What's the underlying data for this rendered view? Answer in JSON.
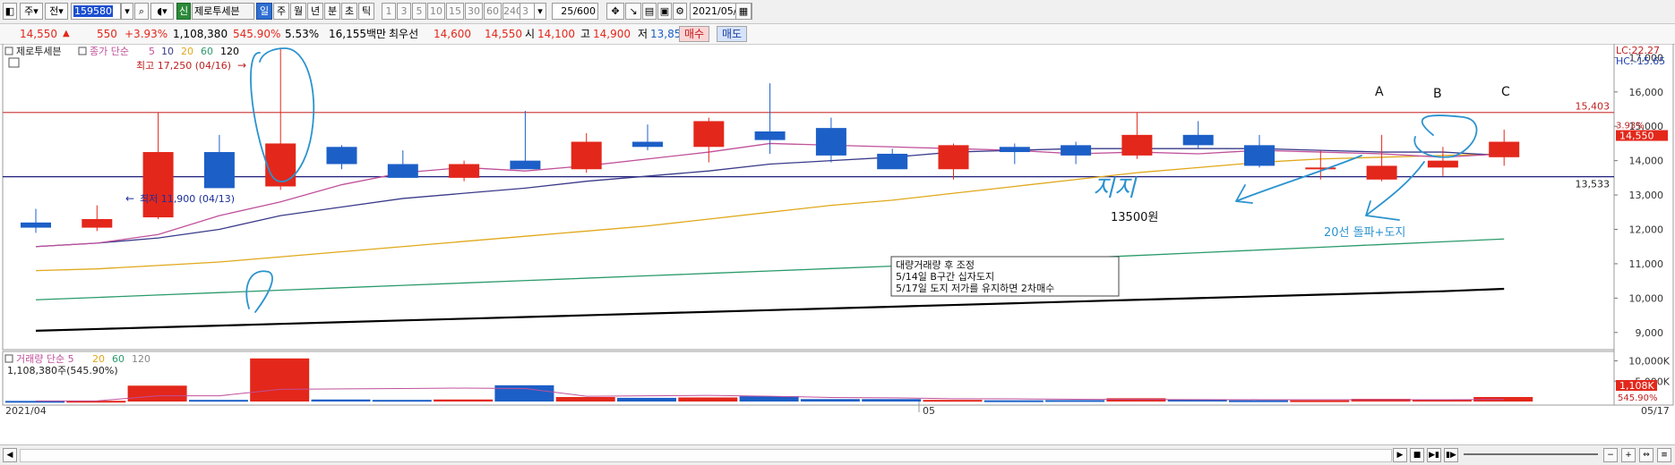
{
  "colors": {
    "up": "#e3271b",
    "down": "#1c5fc7",
    "ma5": "#c0509a",
    "ma10": "#3a3a8a",
    "ma20": "#e0a81a",
    "ma60": "#2a9a6a",
    "ma120": "#000000",
    "annot": "#2b93cf",
    "support_line": "#1f1f7a",
    "resist_line": "#d04848"
  },
  "toolbar": {
    "period_label": "주",
    "type_label": "전",
    "code": "159580",
    "sin_label": "신",
    "stock_name": "제로투세븐",
    "periods": [
      "일",
      "주",
      "월",
      "년",
      "분",
      "초",
      "틱"
    ],
    "selected_period": "일",
    "minute_options": [
      "1",
      "3",
      "5",
      "10",
      "15",
      "30",
      "60",
      "240"
    ],
    "minute_value": "3",
    "count": "25",
    "count_total": "/600",
    "date": "2021/05/17"
  },
  "quote": {
    "price": "14,550",
    "change": "550",
    "change_pct": "+3.93%",
    "volume": "1,108,380",
    "volume_pct": "545.90%",
    "turnover_pct": "5.53%",
    "amount": "16,155백만",
    "priority_label": "최우선",
    "ask": "14,600",
    "bid": "14,550",
    "open_label": "시",
    "open": "14,100",
    "high_label": "고",
    "high": "14,900",
    "low_label": "저",
    "low": "13,850",
    "buy_label": "매수",
    "sell_label": "매도"
  },
  "chart_data": {
    "type": "candlestick",
    "title": "제로투세븐",
    "legend": {
      "ma_label": "종가 단순",
      "periods": [
        "5",
        "10",
        "20",
        "60",
        "120"
      ]
    },
    "y_ticks": [
      "17,000",
      "16,000",
      "15,000",
      "14,000",
      "13,000",
      "12,000",
      "11,000",
      "10,000",
      "9,000"
    ],
    "ylim": [
      8500,
      17400
    ],
    "x_labels": [
      "2021/04",
      "05",
      "05/17"
    ],
    "candles": [
      {
        "o": 12200,
        "h": 12600,
        "l": 11900,
        "c": 12050
      },
      {
        "o": 12050,
        "h": 12700,
        "l": 11950,
        "c": 12300
      },
      {
        "o": 12350,
        "h": 15400,
        "l": 12300,
        "c": 14250
      },
      {
        "o": 14250,
        "h": 14750,
        "l": 13250,
        "c": 13200
      },
      {
        "o": 13250,
        "h": 17250,
        "l": 13150,
        "c": 14500
      },
      {
        "o": 14400,
        "h": 14450,
        "l": 13750,
        "c": 13900
      },
      {
        "o": 13900,
        "h": 14300,
        "l": 13500,
        "c": 13500
      },
      {
        "o": 13500,
        "h": 14000,
        "l": 13400,
        "c": 13900
      },
      {
        "o": 14000,
        "h": 15450,
        "l": 13800,
        "c": 13750
      },
      {
        "o": 13750,
        "h": 14800,
        "l": 13650,
        "c": 14550
      },
      {
        "o": 14550,
        "h": 15050,
        "l": 14300,
        "c": 14400
      },
      {
        "o": 14400,
        "h": 15250,
        "l": 13950,
        "c": 15150
      },
      {
        "o": 14850,
        "h": 16250,
        "l": 14200,
        "c": 14600
      },
      {
        "o": 14950,
        "h": 15250,
        "l": 13950,
        "c": 14150
      },
      {
        "o": 14200,
        "h": 14350,
        "l": 13850,
        "c": 13750
      },
      {
        "o": 13750,
        "h": 14500,
        "l": 13450,
        "c": 14450
      },
      {
        "o": 14400,
        "h": 14500,
        "l": 13900,
        "c": 14250
      },
      {
        "o": 14450,
        "h": 14550,
        "l": 13900,
        "c": 14150
      },
      {
        "o": 14150,
        "h": 15400,
        "l": 14050,
        "c": 14750
      },
      {
        "o": 14750,
        "h": 15150,
        "l": 14350,
        "c": 14450
      },
      {
        "o": 14450,
        "h": 14750,
        "l": 13800,
        "c": 13850
      },
      {
        "o": 13800,
        "h": 14300,
        "l": 13450,
        "c": 13800
      },
      {
        "o": 13450,
        "h": 14750,
        "l": 13400,
        "c": 13850
      },
      {
        "o": 13800,
        "h": 14400,
        "l": 13550,
        "c": 14000
      },
      {
        "o": 14100,
        "h": 14900,
        "l": 13850,
        "c": 14550
      }
    ],
    "ma5": [
      11500,
      11600,
      11850,
      12400,
      12800,
      13300,
      13650,
      13800,
      13700,
      13850,
      14050,
      14250,
      14500,
      14450,
      14400,
      14350,
      14300,
      14200,
      14250,
      14200,
      14300,
      14250,
      14200,
      14100,
      14200
    ],
    "ma10": [
      11500,
      11600,
      11750,
      12000,
      12400,
      12650,
      12900,
      13050,
      13200,
      13400,
      13550,
      13700,
      13900,
      14000,
      14100,
      14250,
      14300,
      14350,
      14350,
      14350,
      14350,
      14300,
      14250,
      14250,
      14150
    ],
    "ma20": [
      10800,
      10850,
      10950,
      11050,
      11200,
      11350,
      11500,
      11650,
      11800,
      11950,
      12100,
      12300,
      12500,
      12700,
      12850,
      13050,
      13250,
      13450,
      13650,
      13800,
      13950,
      14050,
      14100,
      14150,
      14200
    ],
    "ma60": [
      9950,
      10020,
      10090,
      10160,
      10230,
      10300,
      10370,
      10440,
      10510,
      10580,
      10650,
      10720,
      10790,
      10860,
      10930,
      11000,
      11080,
      11160,
      11240,
      11320,
      11400,
      11480,
      11560,
      11640,
      11720
    ],
    "ma120": [
      9050,
      9100,
      9150,
      9200,
      9250,
      9300,
      9350,
      9400,
      9450,
      9500,
      9550,
      9600,
      9650,
      9700,
      9750,
      9800,
      9850,
      9900,
      9950,
      10000,
      10050,
      10100,
      10150,
      10200,
      10270
    ],
    "hlines": [
      {
        "value": 15403,
        "label": "15,403"
      },
      {
        "value": 13533,
        "label": "13,533"
      }
    ],
    "high_marker": "최고 17,250 (04/16)",
    "low_marker": "최저 11,900 (04/13)",
    "lc_label": "LC:22.27",
    "hc_label": "HC:-15.65",
    "current_tag": "14,550",
    "current_pct": "3.93%",
    "volume_panel": {
      "legend": "거래량 단순 5",
      "legend_periods": [
        "20",
        "60",
        "120"
      ],
      "summary": "1,108,380주(545.90%)",
      "y_ticks": [
        "10,000K",
        "5,000K"
      ],
      "ylim": [
        0,
        11000000
      ],
      "values": [
        150000,
        180000,
        3900000,
        400000,
        10600000,
        500000,
        400000,
        500000,
        4000000,
        1100000,
        900000,
        1000000,
        1300000,
        600000,
        600000,
        400000,
        300000,
        350000,
        800000,
        500000,
        300000,
        300000,
        650000,
        450000,
        1108380
      ],
      "current_tag": "1,108K",
      "current_pct": "545.90%",
      "ma5": [
        150000,
        170000,
        1400000,
        1400000,
        3000000,
        3100000,
        3200000,
        3300000,
        3200000,
        1300000,
        1400000,
        1500000,
        1300000,
        1000000,
        900000,
        700000,
        650000,
        550000,
        500000,
        480000,
        450000,
        450000,
        450000,
        450000,
        500000
      ]
    }
  },
  "annotations": {
    "A": "A",
    "B": "B",
    "C": "C",
    "jiji": "지지",
    "price_13500": "13500원",
    "line20": "20선 돌파+도지"
  },
  "note_box": {
    "lines": [
      "대량거래량 후 조정",
      "5/14일 B구간 십자도지",
      "5/17일 도지 저가를 유지하면 2차매수"
    ]
  }
}
